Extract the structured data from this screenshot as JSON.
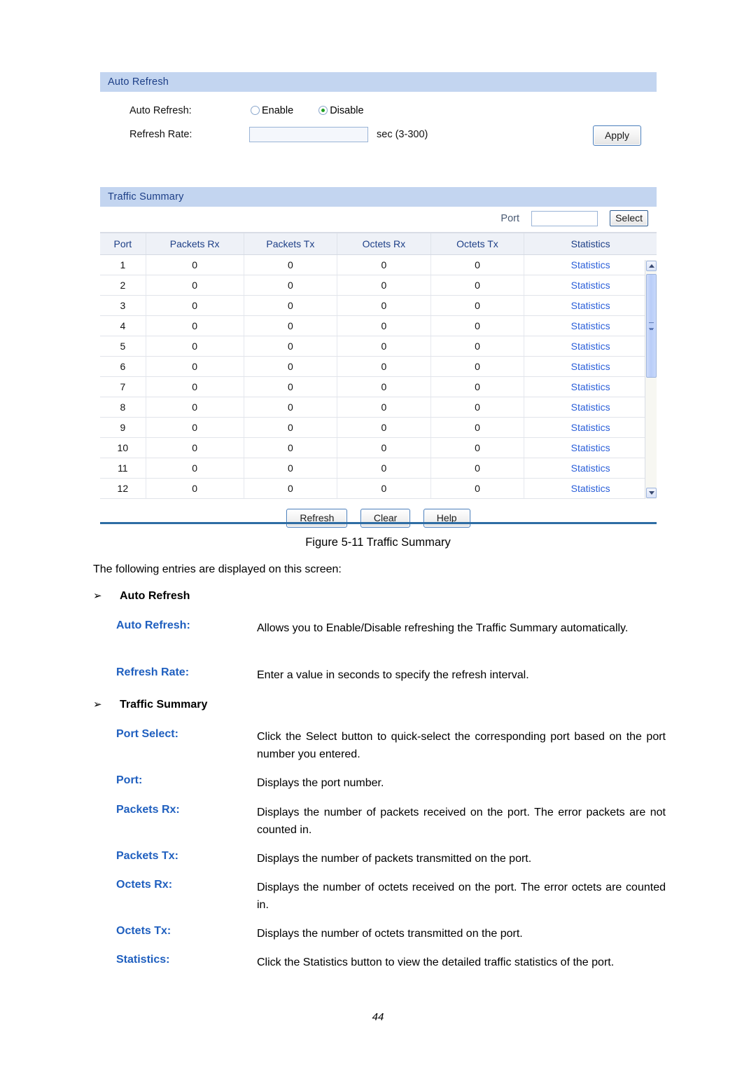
{
  "figure": {
    "auto_refresh_panel": {
      "title": "Auto Refresh",
      "auto_refresh_label": "Auto Refresh:",
      "radios": [
        {
          "label": "Enable",
          "checked": false
        },
        {
          "label": "Disable",
          "checked": true
        }
      ],
      "refresh_rate_label": "Refresh Rate:",
      "refresh_rate_value": "",
      "refresh_rate_placeholder": "",
      "refresh_rate_unit": "sec (3-300)",
      "apply_label": "Apply"
    },
    "traffic_summary_panel": {
      "title": "Traffic Summary",
      "port_select_label": "Port",
      "port_select_value": "",
      "port_select_button": "Select",
      "columns": [
        "Port",
        "Packets Rx",
        "Packets Tx",
        "Octets Rx",
        "Octets Tx",
        "Statistics"
      ],
      "rows": [
        {
          "port": "1",
          "packets_rx": "0",
          "packets_tx": "0",
          "octets_rx": "0",
          "octets_tx": "0",
          "statistics": "Statistics"
        },
        {
          "port": "2",
          "packets_rx": "0",
          "packets_tx": "0",
          "octets_rx": "0",
          "octets_tx": "0",
          "statistics": "Statistics"
        },
        {
          "port": "3",
          "packets_rx": "0",
          "packets_tx": "0",
          "octets_rx": "0",
          "octets_tx": "0",
          "statistics": "Statistics"
        },
        {
          "port": "4",
          "packets_rx": "0",
          "packets_tx": "0",
          "octets_rx": "0",
          "octets_tx": "0",
          "statistics": "Statistics"
        },
        {
          "port": "5",
          "packets_rx": "0",
          "packets_tx": "0",
          "octets_rx": "0",
          "octets_tx": "0",
          "statistics": "Statistics"
        },
        {
          "port": "6",
          "packets_rx": "0",
          "packets_tx": "0",
          "octets_rx": "0",
          "octets_tx": "0",
          "statistics": "Statistics"
        },
        {
          "port": "7",
          "packets_rx": "0",
          "packets_tx": "0",
          "octets_rx": "0",
          "octets_tx": "0",
          "statistics": "Statistics"
        },
        {
          "port": "8",
          "packets_rx": "0",
          "packets_tx": "0",
          "octets_rx": "0",
          "octets_tx": "0",
          "statistics": "Statistics"
        },
        {
          "port": "9",
          "packets_rx": "0",
          "packets_tx": "0",
          "octets_rx": "0",
          "octets_tx": "0",
          "statistics": "Statistics"
        },
        {
          "port": "10",
          "packets_rx": "0",
          "packets_tx": "0",
          "octets_rx": "0",
          "octets_tx": "0",
          "statistics": "Statistics"
        },
        {
          "port": "11",
          "packets_rx": "0",
          "packets_tx": "0",
          "octets_rx": "0",
          "octets_tx": "0",
          "statistics": "Statistics"
        },
        {
          "port": "12",
          "packets_rx": "0",
          "packets_tx": "0",
          "octets_rx": "0",
          "octets_tx": "0",
          "statistics": "Statistics"
        }
      ],
      "footer_buttons": [
        "Refresh",
        "Clear",
        "Help"
      ]
    },
    "colors": {
      "panel_header_bg": "#c3d5f0",
      "panel_header_text": "#1d3f87",
      "table_header_bg": "#eef1f7",
      "link": "#2b5fd9",
      "rule": "#2e6da4",
      "term_accent": "#1f5fbf",
      "radio_dot": "#21a021"
    }
  },
  "document": {
    "caption": "Figure 5-11 Traffic Summary",
    "intro": "The following entries are displayed on this screen:",
    "sections": [
      {
        "bullet": "➢",
        "heading": "Auto Refresh",
        "entries": [
          {
            "term": "Auto Refresh:",
            "desc": "Allows you to Enable/Disable refreshing the Traffic Summary automatically."
          },
          {
            "term": "Refresh Rate:",
            "desc": "Enter a value in seconds to specify the refresh interval."
          }
        ]
      },
      {
        "bullet": "➢",
        "heading": "Traffic Summary",
        "entries": [
          {
            "term": "Port Select:",
            "desc": "Click the Select button to quick-select the corresponding port based on the port number you entered."
          },
          {
            "term": "Port:",
            "desc": "Displays the port number."
          },
          {
            "term": "Packets Rx:",
            "desc": "Displays the number of packets received on the port. The error packets are not counted in."
          },
          {
            "term": "Packets Tx:",
            "desc": "Displays the number of packets transmitted on the port."
          },
          {
            "term": "Octets Rx:",
            "desc": "Displays the number of octets received on the port. The error octets are counted in."
          },
          {
            "term": "Octets Tx:",
            "desc": "Displays the number of octets transmitted on the port."
          },
          {
            "term": "Statistics:",
            "desc": "Click the Statistics button to view the detailed traffic statistics of the port."
          }
        ]
      }
    ],
    "page_number": "44"
  }
}
